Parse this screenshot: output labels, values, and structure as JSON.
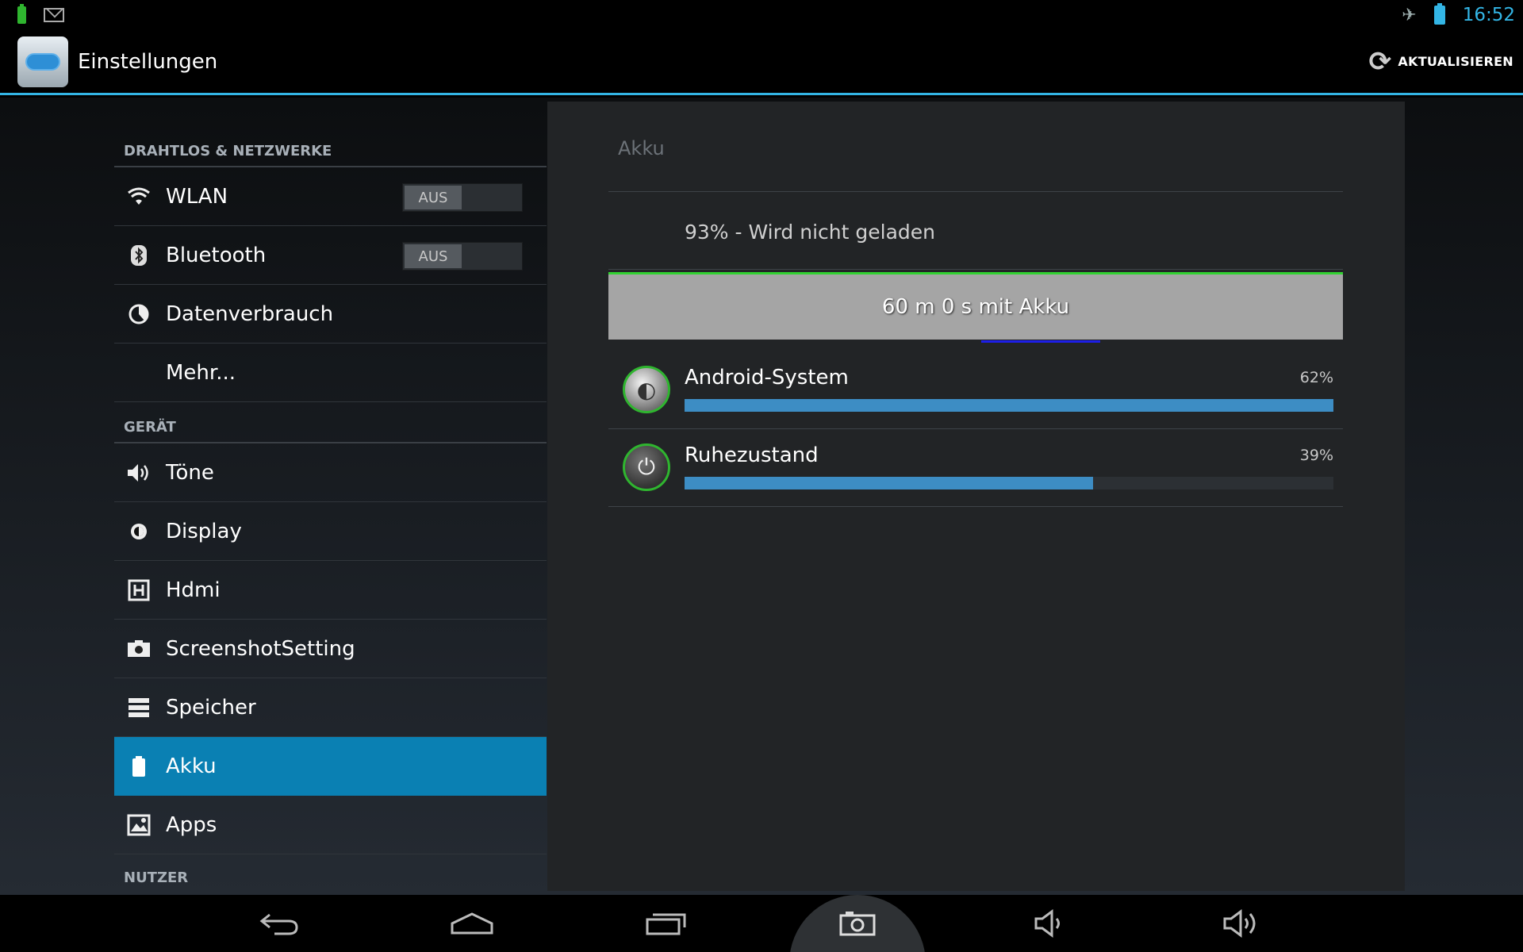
{
  "status_bar": {
    "time": "16:52"
  },
  "action_bar": {
    "title": "Einstellungen",
    "refresh_label": "AKTUALISIEREN"
  },
  "sections": {
    "wireless": "DRAHTLOS & NETZWERKE",
    "device": "GERÄT",
    "user": "NUTZER"
  },
  "items": {
    "wlan": {
      "label": "WLAN",
      "toggle": "AUS"
    },
    "bluetooth": {
      "label": "Bluetooth",
      "toggle": "AUS"
    },
    "data": {
      "label": "Datenverbrauch"
    },
    "more": {
      "label": "Mehr..."
    },
    "sound": {
      "label": "Töne"
    },
    "display": {
      "label": "Display"
    },
    "hdmi": {
      "label": "Hdmi"
    },
    "screenshot": {
      "label": "ScreenshotSetting"
    },
    "storage": {
      "label": "Speicher"
    },
    "battery": {
      "label": "Akku"
    },
    "apps": {
      "label": "Apps"
    }
  },
  "panel": {
    "title": "Akku",
    "status": "93% - Wird nicht geladen",
    "graph_label": "60 m 0 s mit Akku",
    "usage": [
      {
        "name": "Android-System",
        "percent_label": "62%",
        "fraction": 1.0
      },
      {
        "name": "Ruhezustand",
        "percent_label": "39%",
        "fraction": 0.63
      }
    ]
  },
  "colors": {
    "accent": "#33b5e5",
    "active_item": "#0a80b3",
    "bar": "#3d8dc4",
    "graph_line": "#31d231"
  }
}
